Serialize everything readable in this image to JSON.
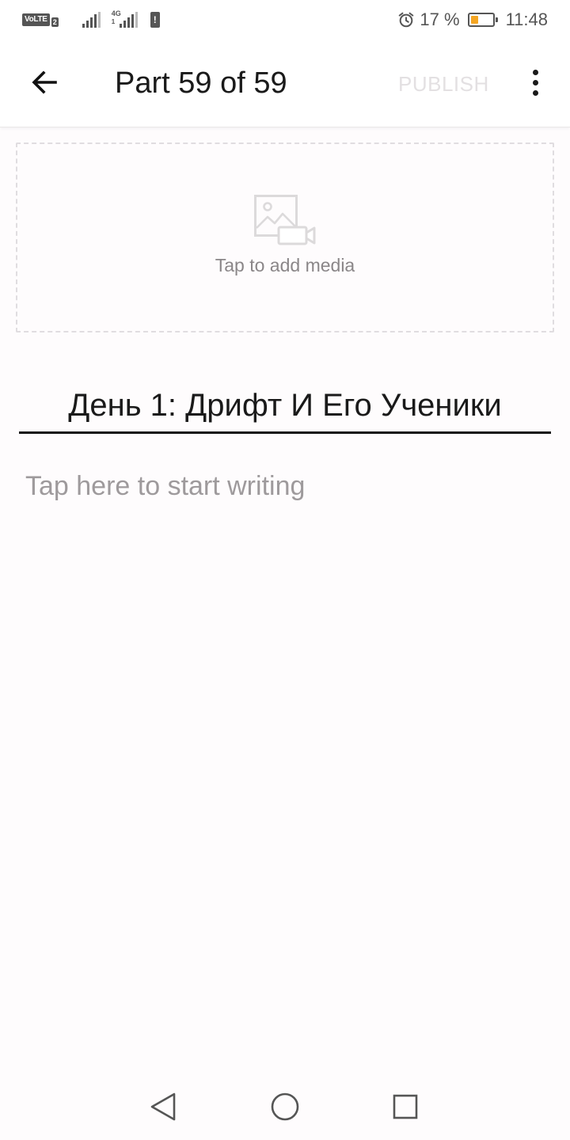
{
  "status_bar": {
    "volte_label": "VoLTE",
    "sim_slot": "2",
    "network_type": "4G",
    "network_sub": "1",
    "alert_mark": "!",
    "battery_text": "17 %",
    "battery_level": 0.17,
    "battery_color": "#f5a623",
    "time": "11:48"
  },
  "app_bar": {
    "title": "Part 59 of 59",
    "publish_label": "PUBLISH",
    "publish_color": "#e3e0e2"
  },
  "media": {
    "label": "Tap to add media",
    "icon": "image-video-icon"
  },
  "editor": {
    "title_value": "День 1: Дрифт И Его Ученики",
    "body_placeholder": "Tap here to start writing"
  },
  "nav_bar": {
    "icons": [
      "back-triangle-icon",
      "home-circle-icon",
      "recents-square-icon"
    ]
  }
}
